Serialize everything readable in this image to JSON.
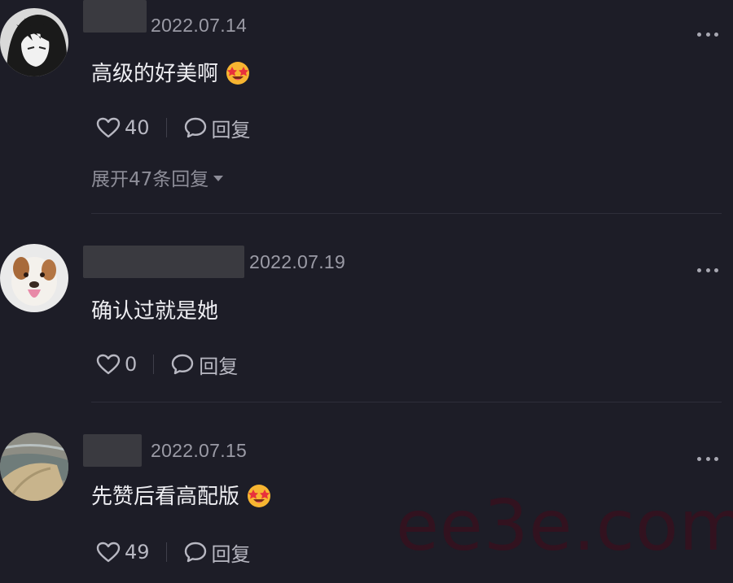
{
  "comments": [
    {
      "date": "2022.07.14",
      "text": "高级的好美啊",
      "emoji": "star-struck-emoji",
      "likes": "40",
      "reply_label": "回复",
      "expand_label": "展开47条回复"
    },
    {
      "date": "2022.07.19",
      "text": "确认过就是她",
      "likes": "0",
      "reply_label": "回复"
    },
    {
      "date": "2022.07.15",
      "text": "先赞后看高配版",
      "emoji": "star-struck-emoji",
      "likes": "49",
      "reply_label": "回复"
    }
  ],
  "watermark": "ee3e.com",
  "icons": {
    "like": "heart-outline-icon",
    "reply": "speech-bubble-icon",
    "more": "more-dots-icon",
    "expand": "caret-down-icon"
  },
  "colors": {
    "background": "#1d1d27",
    "text": "#eeeef2",
    "muted": "#9b9ba6",
    "watermark": "#32121f"
  }
}
